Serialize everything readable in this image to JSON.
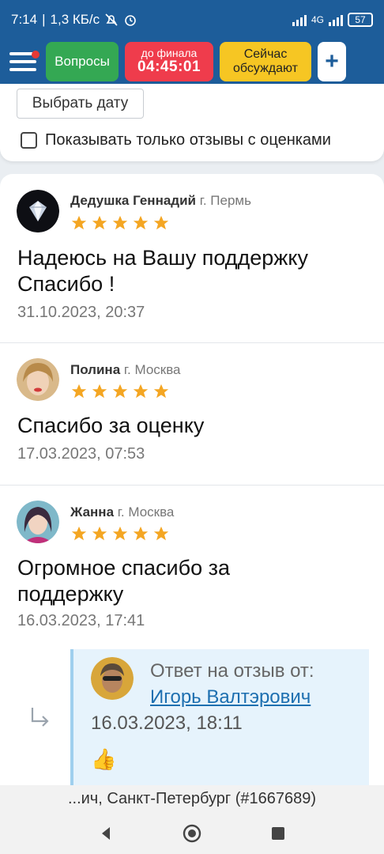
{
  "status_bar": {
    "time": "7:14",
    "speed": "1,3 КБ/с",
    "network": "4G",
    "battery": "57"
  },
  "nav": {
    "questions_label": "Вопросы",
    "final_label": "до финала",
    "final_time": "04:45:01",
    "discuss_line1": "Сейчас",
    "discuss_line2": "обсуждают",
    "plus_label": "+"
  },
  "filters": {
    "date_button": "Выбрать дату",
    "only_rated_label": "Показывать только отзывы с оценками",
    "only_rated_checked": false
  },
  "reviews": [
    {
      "author": "Дедушка Геннадий",
      "city": "г. Пермь",
      "rating": 5,
      "text": "Надеюсь на Вашу поддержку Спасибо !",
      "date": "31.10.2023, 20:37"
    },
    {
      "author": "Полина",
      "city": "г. Москва",
      "rating": 5,
      "text": "Спасибо за оценку",
      "date": "17.03.2023, 07:53"
    },
    {
      "author": "Жанна",
      "city": "г. Москва",
      "rating": 5,
      "text": "Огромное спасибо за поддержку",
      "date": "16.03.2023, 17:41",
      "reply": {
        "title": "Ответ на отзыв от:",
        "author": "Игорь Валтэрович",
        "date": "16.03.2023, 18:11",
        "text": "👍"
      }
    }
  ],
  "bottom_banner": "...ич, Санкт-Петербург (#1667689)",
  "colors": {
    "brand": "#1d5d9a",
    "star": "#f4a623",
    "questions": "#34a853",
    "final": "#ef3c4c",
    "discuss": "#f6c623"
  }
}
